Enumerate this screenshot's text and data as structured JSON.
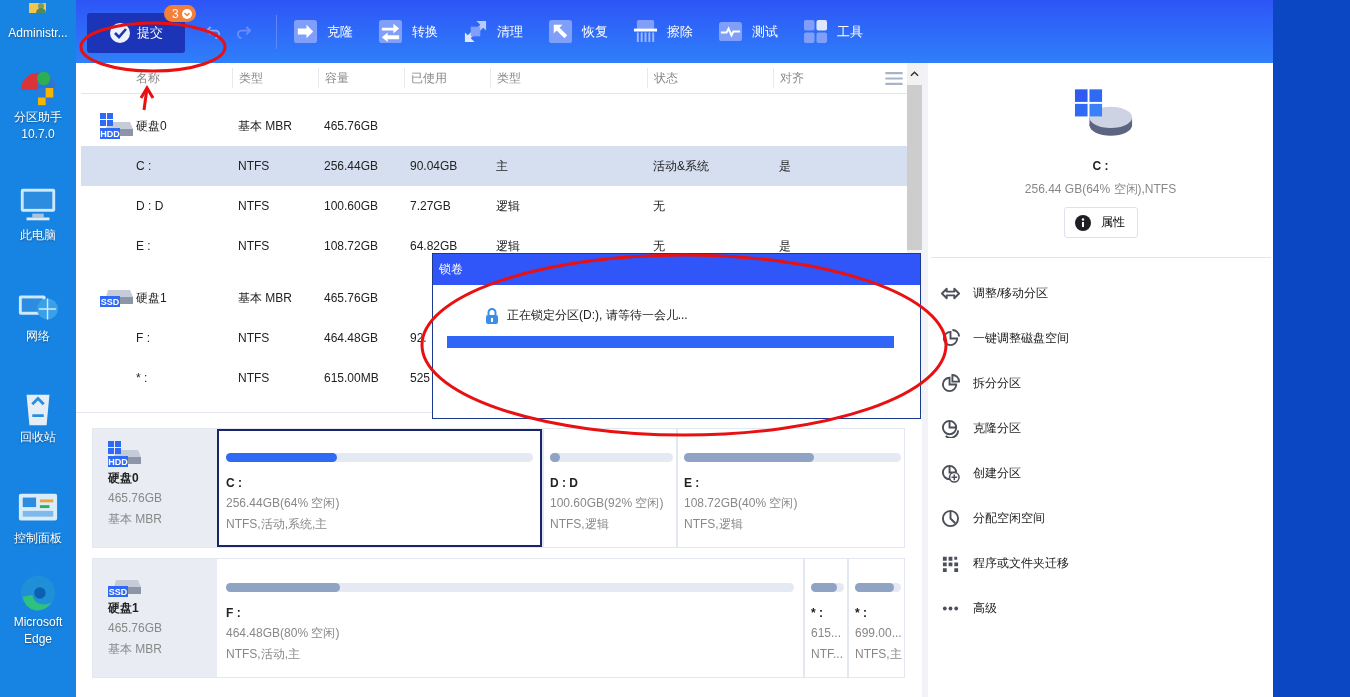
{
  "desktop_left": [
    {
      "label": "Administr...",
      "kind": "user-folder"
    },
    {
      "label": "分区助手 10.7.0",
      "kind": "partition-app"
    },
    {
      "label": "此电脑",
      "kind": "computer"
    },
    {
      "label": "网络",
      "kind": "network"
    },
    {
      "label": "回收站",
      "kind": "recycle-bin"
    },
    {
      "label": "控制面板",
      "kind": "control-panel"
    },
    {
      "label": "Microsoft Edge",
      "kind": "edge"
    }
  ],
  "toolbar": {
    "submit": {
      "label": "提交",
      "badge": "3"
    },
    "tools": [
      {
        "label": "克隆",
        "kind": "clone"
      },
      {
        "label": "转换",
        "kind": "convert"
      },
      {
        "label": "清理",
        "kind": "clean"
      },
      {
        "label": "恢复",
        "kind": "recover"
      },
      {
        "label": "擦除",
        "kind": "wipe"
      },
      {
        "label": "测试",
        "kind": "test"
      },
      {
        "label": "工具",
        "kind": "tools"
      }
    ]
  },
  "table": {
    "columns": [
      "名称",
      "类型",
      "容量",
      "已使用",
      "类型",
      "状态",
      "对齐"
    ],
    "rows": [
      {
        "kind": "disk",
        "drive": "HDD",
        "selected": false,
        "name": "硬盘0",
        "type": "基本 MBR",
        "capacity": "465.76GB"
      },
      {
        "kind": "partition",
        "selected": true,
        "name": "C :",
        "type": "NTFS",
        "capacity": "256.44GB",
        "used": "90.04GB",
        "ptype": "主",
        "status": "活动&系统",
        "align": "是"
      },
      {
        "kind": "partition",
        "selected": false,
        "name": "D : D",
        "type": "NTFS",
        "capacity": "100.60GB",
        "used": "7.27GB",
        "ptype": "逻辑",
        "status": "无"
      },
      {
        "kind": "partition",
        "selected": false,
        "name": "E :",
        "type": "NTFS",
        "capacity": "108.72GB",
        "used": "64.82GB",
        "ptype": "逻辑",
        "status": "无",
        "align": "是"
      },
      {
        "kind": "disk",
        "drive": "SSD",
        "selected": false,
        "name": "硬盘1",
        "type": "基本 MBR",
        "capacity": "465.76GB"
      },
      {
        "kind": "partition",
        "selected": false,
        "name": "F :",
        "type": "NTFS",
        "capacity": "464.48GB",
        "used": "92."
      },
      {
        "kind": "partition",
        "selected": false,
        "name": "* :",
        "type": "NTFS",
        "capacity": "615.00MB",
        "used": "525"
      }
    ]
  },
  "disk_map": [
    {
      "name": "硬盘0",
      "drive": "HDD",
      "capacity": "465.76GB",
      "type": "基本 MBR",
      "partitions": [
        {
          "name": "C :",
          "size": "256.44GB(64% 空闲)",
          "info": "NTFS,活动,系统,主",
          "level": 0.36,
          "selected": true
        },
        {
          "name": "D : D",
          "size": "100.60GB(92% 空闲)",
          "info": "NTFS,逻辑",
          "level": 0.08,
          "selected": false
        },
        {
          "name": "E :",
          "size": "108.72GB(40% 空闲)",
          "info": "NTFS,逻辑",
          "level": 0.6,
          "selected": false
        }
      ]
    },
    {
      "name": "硬盘1",
      "drive": "SSD",
      "capacity": "465.76GB",
      "type": "基本 MBR",
      "partitions": [
        {
          "name": "F :",
          "size": "464.48GB(80% 空闲)",
          "info": "NTFS,活动,主",
          "level": 0.2,
          "selected": false
        },
        {
          "name": "* :",
          "size": "615...",
          "info": "NTF...",
          "level": 0.8,
          "selected": false
        },
        {
          "name": "* :",
          "size": "699.00...",
          "info": "NTFS,主",
          "level": 0.85,
          "selected": false
        }
      ]
    }
  ],
  "side_panel": {
    "drive_name": "C :",
    "summary": "256.44 GB(64% 空闲),NTFS",
    "properties_button": "属性",
    "actions": [
      {
        "label": "调整/移动分区",
        "kind": "resize"
      },
      {
        "label": "一键调整磁盘空间",
        "kind": "auto"
      },
      {
        "label": "拆分分区",
        "kind": "split"
      },
      {
        "label": "克隆分区",
        "kind": "clone"
      },
      {
        "label": "创建分区",
        "kind": "create"
      },
      {
        "label": "分配空闲空间",
        "kind": "allocate"
      },
      {
        "label": "程序或文件夹迁移",
        "kind": "migrate"
      },
      {
        "label": "高级",
        "kind": "more"
      }
    ]
  },
  "dialog": {
    "title": "锁卷",
    "message": "正在锁定分区(D:), 请等待一会儿...",
    "level": 1
  },
  "annotations": [
    {
      "kind": "ellipse"
    },
    {
      "kind": "arrow"
    },
    {
      "kind": "ellipse"
    }
  ]
}
